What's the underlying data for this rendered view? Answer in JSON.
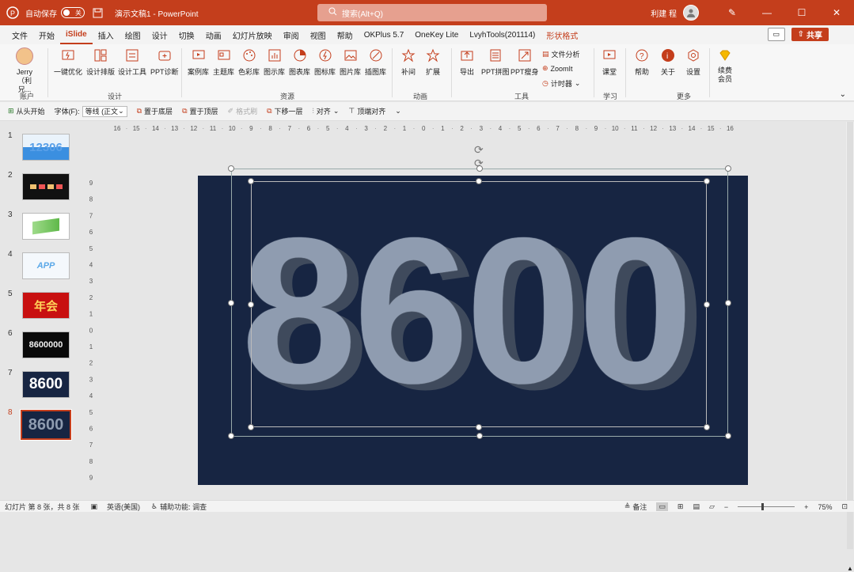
{
  "titlebar": {
    "autosave_label": "自动保存",
    "autosave_state": "关",
    "doc_title": "演示文稿1 - PowerPoint",
    "search_placeholder": "搜索(Alt+Q)",
    "user_name": "利建 程"
  },
  "menu": {
    "tabs": [
      "文件",
      "开始",
      "iSlide",
      "插入",
      "绘图",
      "设计",
      "切换",
      "动画",
      "幻灯片放映",
      "审阅",
      "视图",
      "帮助",
      "OKPlus 5.7",
      "OneKey Lite",
      "LvyhTools(201114)",
      "形状格式"
    ],
    "active_index": 2,
    "share_label": "共享"
  },
  "ribbon": {
    "account_label": "Jerry（利兄...",
    "groups": {
      "account": "账户",
      "design": "设计",
      "resources": "资源",
      "animation": "动画",
      "tools": "工具",
      "study": "学习",
      "more": "更多"
    },
    "buttons": {
      "one_click": "一键优化",
      "layout": "设计排版",
      "design_tools": "设计工具",
      "ppt_diag": "PPT诊断",
      "cases": "案例库",
      "themes": "主题库",
      "colors": "色彩库",
      "charts": "图示库",
      "graph": "图表库",
      "icons": "图标库",
      "images": "图片库",
      "illustrations": "插图库",
      "tween": "补间",
      "extend": "扩展",
      "export": "导出",
      "ppt_collage": "PPT拼图",
      "ppt_slim": "PPT瘦身",
      "file_analysis": "文件分析",
      "zoomit": "ZoomIt",
      "timer": "计时器",
      "classroom": "课堂",
      "help": "帮助",
      "about": "关于",
      "settings": "设置",
      "renew": "续费会员"
    }
  },
  "qat": {
    "from_start": "从头开始",
    "font_label": "字体(F):",
    "font_value": "等线 (正文",
    "bring_bottom": "置于底层",
    "bring_top": "置于顶层",
    "format_painter": "格式刷",
    "down_one": "下移一层",
    "align": "对齐",
    "top_align": "顶端对齐"
  },
  "thumbnails": [
    {
      "num": "1",
      "text": "12306"
    },
    {
      "num": "2",
      "text": ""
    },
    {
      "num": "3",
      "text": ""
    },
    {
      "num": "4",
      "text": "APP"
    },
    {
      "num": "5",
      "text": "年会"
    },
    {
      "num": "6",
      "text": "8600000"
    },
    {
      "num": "7",
      "text": "8600"
    },
    {
      "num": "8",
      "text": "8600"
    }
  ],
  "ruler": {
    "h_ticks": [
      "16",
      "15",
      "14",
      "13",
      "12",
      "11",
      "10",
      "9",
      "8",
      "7",
      "6",
      "5",
      "4",
      "3",
      "2",
      "1",
      "0",
      "1",
      "2",
      "3",
      "4",
      "5",
      "6",
      "7",
      "8",
      "9",
      "10",
      "11",
      "12",
      "13",
      "14",
      "15",
      "16"
    ],
    "v_ticks": [
      "9",
      "8",
      "7",
      "6",
      "5",
      "4",
      "3",
      "2",
      "1",
      "0",
      "1",
      "2",
      "3",
      "4",
      "5",
      "6",
      "7",
      "8",
      "9"
    ]
  },
  "slide": {
    "main_text": "8600",
    "bg_color": "#172542",
    "text_color": "#8f9cb0",
    "shadow_color": "#3f4a5c"
  },
  "status": {
    "slide_info": "幻灯片 第 8 张，共 8 张",
    "language": "英语(美国)",
    "accessibility": "辅助功能: 调查",
    "notes": "备注",
    "zoom": "75%"
  },
  "colors": {
    "accent": "#c43e1c"
  }
}
